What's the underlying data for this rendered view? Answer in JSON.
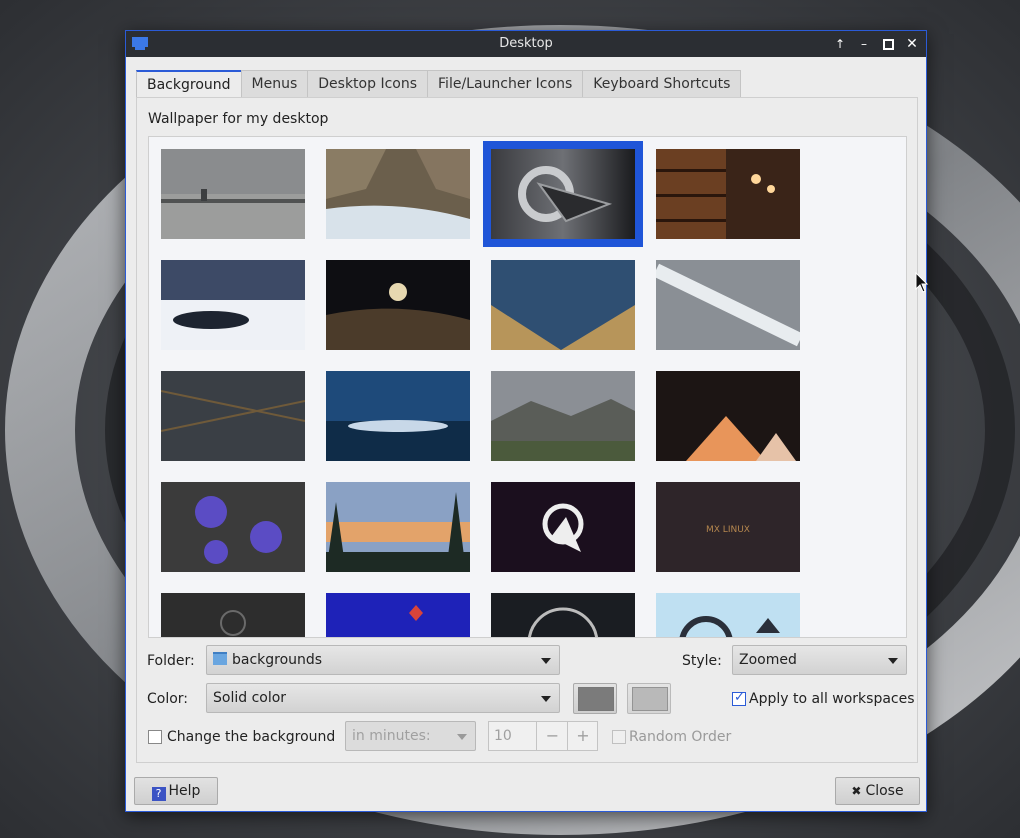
{
  "window": {
    "title": "Desktop"
  },
  "tabs": [
    {
      "label": "Background",
      "active": true
    },
    {
      "label": "Menus",
      "active": false
    },
    {
      "label": "Desktop Icons",
      "active": false
    },
    {
      "label": "File/Launcher Icons",
      "active": false
    },
    {
      "label": "Keyboard Shortcuts",
      "active": false
    }
  ],
  "background": {
    "wallpaper_label": "Wallpaper for my desktop",
    "selected_index": 2,
    "folder_label": "Folder:",
    "folder_value": "backgrounds",
    "style_label": "Style:",
    "style_value": "Zoomed",
    "color_label": "Color:",
    "color_value": "Solid color",
    "color1": "#7b7b7b",
    "color2": "#a9a9a9",
    "apply_all_label": "Apply to all workspaces",
    "apply_all_checked": true,
    "change_bg_label": "Change the background",
    "change_bg_checked": false,
    "interval_value": "in minutes:",
    "minutes_value": "10",
    "random_order_label": "Random Order"
  },
  "footer": {
    "help_label": "Help",
    "close_label": "Close"
  },
  "colors": {
    "accent": "#2b5bd7",
    "titlebar": "#2b2e33"
  }
}
